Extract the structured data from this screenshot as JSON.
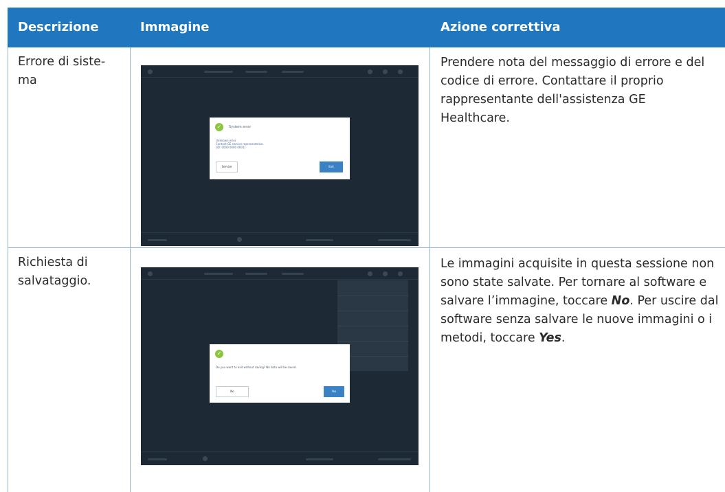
{
  "header": {
    "col1": "Descrizione",
    "col2": "Immagine",
    "col3": "Azione correttiva"
  },
  "rows": [
    {
      "description_line1": "Errore di siste-",
      "description_line2": "ma",
      "action": "Prendere nota del messaggio di errore e del codice di errore. Contattare il proprio rappresentante dell'assistenza GE Healthcare.",
      "screenshot": {
        "dialog_title": "System error",
        "dialog_line1": "Unknown error",
        "dialog_line2": "Contact GE service representative.",
        "dialog_line3": "[ID: 0000 0000 0001]",
        "button_left": "Service",
        "button_right": "Exit"
      }
    },
    {
      "description_line1": "Richiesta di",
      "description_line2": "salvataggio.",
      "action_part1": "Le immagini acquisite in questa sessione non sono state salvate. Per tornare al software e salvare l’immagine, toccare ",
      "action_em1": "No",
      "action_part2": ". Per uscire dal software senza salvare le nuove immagini o i metodi, toccare ",
      "action_em2": "Yes",
      "action_part3": ".",
      "screenshot": {
        "dialog_body": "Do you want to exit without saving? No data will be saved.",
        "button_left": "No",
        "button_right": "Yes"
      }
    }
  ],
  "colors": {
    "header_bg": "#1f77c0",
    "grid_line": "#8fb6d8",
    "screen_bg": "#1d2a36",
    "check_green": "#8cc63f",
    "button_blue": "#3b82c4"
  }
}
